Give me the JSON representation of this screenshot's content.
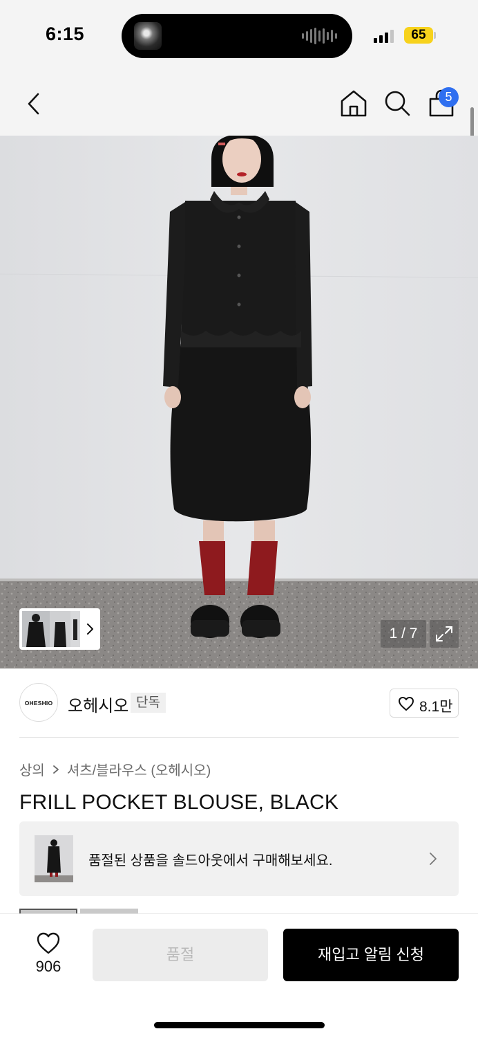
{
  "status_bar": {
    "time": "6:15",
    "battery": "65",
    "icons": [
      "now-playing-artwork",
      "audio-waveform-icon",
      "signal-icon",
      "battery-icon"
    ]
  },
  "nav": {
    "icons": [
      "back-chevron-icon",
      "home-icon",
      "search-icon",
      "shopping-bag-icon"
    ],
    "cart_count": "5"
  },
  "gallery": {
    "counter": "1 / 7",
    "icons": [
      "thumbnail-next-chevron-icon",
      "expand-icon"
    ]
  },
  "brand": {
    "logo_text": "OHESHIO",
    "name": "오헤시오",
    "badge": "단독",
    "like_count": "8.1만"
  },
  "product": {
    "breadcrumb": [
      "상의",
      "셔츠/블라우스 (오헤시오)"
    ],
    "title": "FRILL POCKET BLOUSE, BLACK"
  },
  "soldout_banner": {
    "text": "품절된 상품을 솔드아웃에서 구매해보세요."
  },
  "bottom_bar": {
    "wish_count": "906",
    "soldout_label": "품절",
    "restock_label": "재입고 알림 신청"
  },
  "colors": {
    "background": "#f4f4f4",
    "badge_blue": "#2f6ff0",
    "battery_yellow": "#f7d21c",
    "primary_button": "#000000",
    "disabled_button": "#ececec",
    "socks_red": "#8e1a1e"
  }
}
